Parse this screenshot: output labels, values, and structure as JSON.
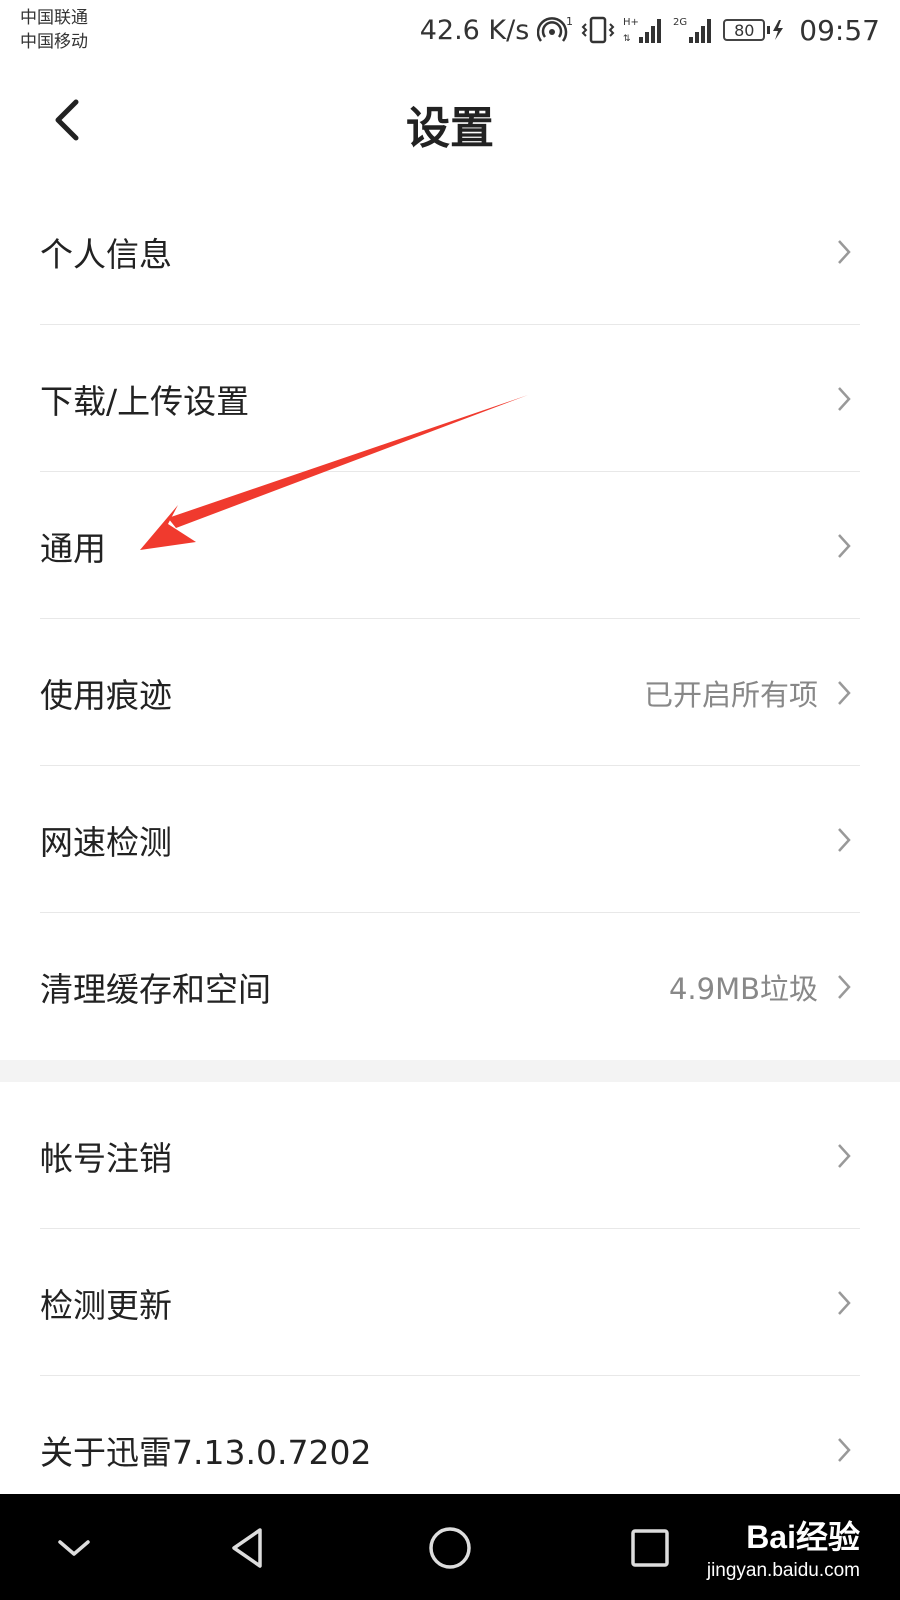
{
  "status_bar": {
    "carrier_1": "中国联通",
    "carrier_2": "中国移动",
    "net_speed": "42.6 K/s",
    "battery": "80",
    "time": "09:57",
    "icons": [
      "hotspot-icon",
      "vibrate-icon",
      "signal-h-plus-icon",
      "signal-2g-icon",
      "battery-icon",
      "charging-icon"
    ]
  },
  "header": {
    "title": "设置",
    "back_icon": "back-chevron-icon"
  },
  "settings": {
    "items": [
      {
        "label": "个人信息",
        "value": ""
      },
      {
        "label": "下载/上传设置",
        "value": ""
      },
      {
        "label": "通用",
        "value": ""
      },
      {
        "label": "使用痕迹",
        "value": "已开启所有项"
      },
      {
        "label": "网速检测",
        "value": ""
      },
      {
        "label": "清理缓存和空间",
        "value": "4.9MB垃圾"
      }
    ],
    "items2": [
      {
        "label": "帐号注销",
        "value": ""
      },
      {
        "label": "检测更新",
        "value": ""
      },
      {
        "label": "关于迅雷7.13.0.7202",
        "value": ""
      }
    ]
  },
  "annotation": {
    "color": "#f03a2e",
    "target": "通用"
  },
  "nav_bar": {
    "buttons": [
      "chevron-down-icon",
      "back-triangle-icon",
      "home-circle-icon",
      "recents-square-icon"
    ],
    "watermark_logo": "Bai经验",
    "watermark_url": "jingyan.baidu.com"
  },
  "colors": {
    "background": "#ffffff",
    "divider": "#e8e8e8",
    "section_gap": "#f3f3f3",
    "secondary_text": "#888888",
    "navbar": "#000000"
  }
}
